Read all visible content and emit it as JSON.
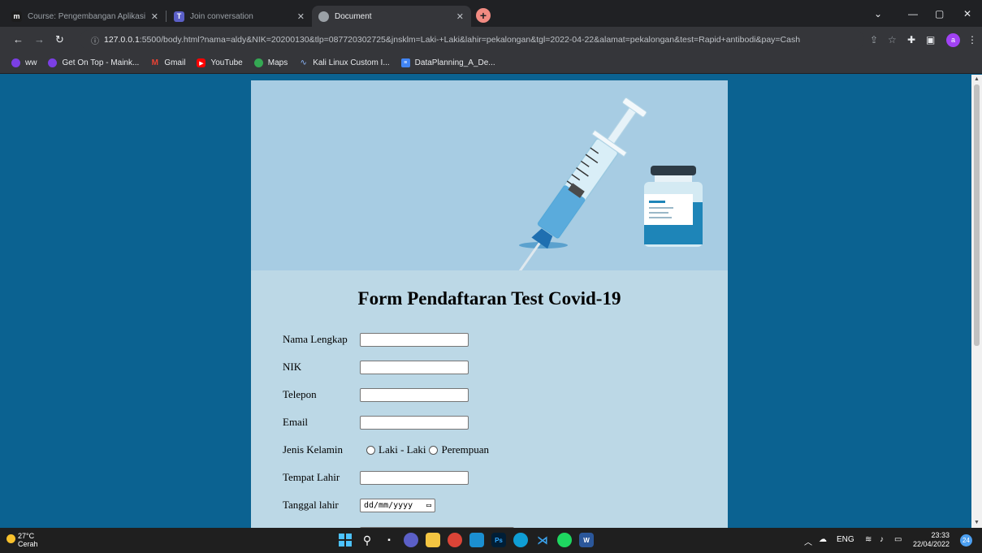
{
  "browser": {
    "tabs": [
      {
        "icon_text": "m",
        "label": "Course: Pengembangan Aplikasi",
        "active": false
      },
      {
        "icon_text": "T",
        "label": "Join conversation",
        "active": false
      },
      {
        "icon_text": "",
        "label": "Document",
        "active": true
      }
    ],
    "address": {
      "host": "127.0.0.1",
      "rest": ":5500/body.html?nama=aldy&NIK=20200130&tlp=087720302725&jnsklm=Laki-+Laki&lahir=pekalongan&tgl=2022-04-22&alamat=pekalongan&test=Rapid+antibodi&pay=Cash"
    },
    "profile_initial": "a",
    "bookmarks": [
      "ww",
      "Get On Top - Maink...",
      "Gmail",
      "YouTube",
      "Maps",
      "Kali Linux Custom I...",
      "DataPlanning_A_De..."
    ],
    "colors": {
      "chrome_dark": "#202124",
      "toolbar": "#35363a",
      "page_bg": "#0b6291"
    }
  },
  "form": {
    "title": "Form Pendaftaran Test Covid-19",
    "fields": {
      "nama": {
        "label": "Nama Lengkap",
        "value": ""
      },
      "nik": {
        "label": "NIK",
        "value": ""
      },
      "telepon": {
        "label": "Telepon",
        "value": ""
      },
      "email": {
        "label": "Email",
        "value": ""
      },
      "gender": {
        "label": "Jenis Kelamin",
        "options": [
          "Laki - Laki",
          "Perempuan"
        ]
      },
      "tempat_lahir": {
        "label": "Tempat Lahir",
        "value": ""
      },
      "tanggal_lahir": {
        "label": "Tanggal lahir",
        "placeholder": "dd/mm/yyyy"
      }
    },
    "colors": {
      "card_bg": "#bcd8e6",
      "hero_bg": "#a7cce3"
    }
  },
  "taskbar": {
    "weather": {
      "temp": "27°C",
      "condition": "Cerah"
    },
    "tray": {
      "language": "ENG"
    },
    "clock": {
      "time": "23:33",
      "date": "22/04/2022"
    },
    "notification_count": "24"
  }
}
